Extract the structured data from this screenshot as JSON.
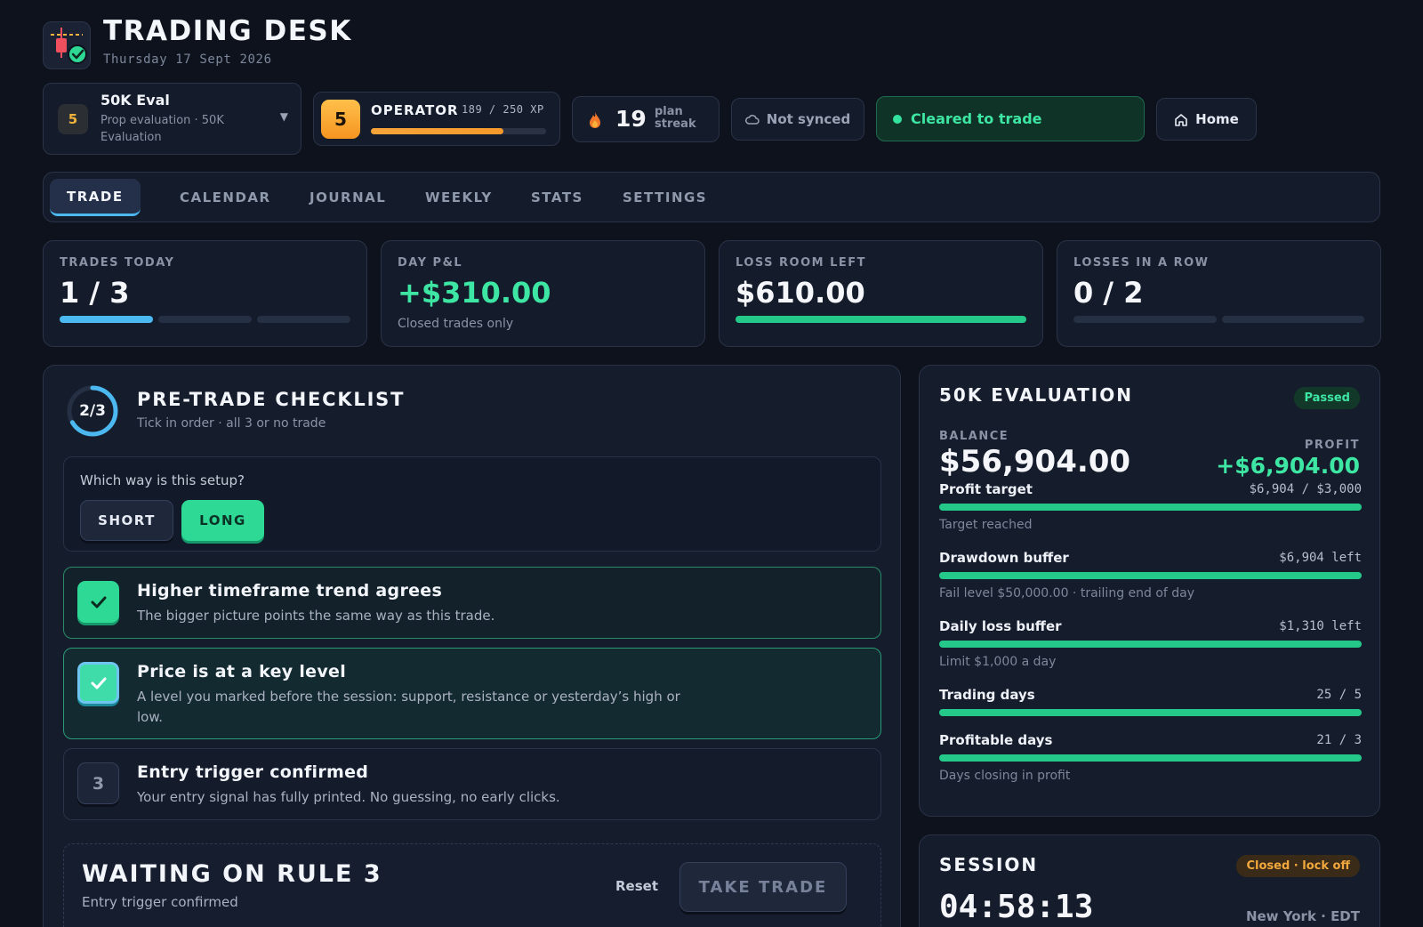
{
  "header": {
    "title": "TRADING DESK",
    "date": "Thursday 17 Sept 2026"
  },
  "account": {
    "badge": "5",
    "name": "50K Eval",
    "description": "Prop evaluation · 50K Evaluation"
  },
  "level": {
    "level": "5",
    "rank": "OPERATOR",
    "xp_text": "189 / 250 XP",
    "xp_progress": 0.756
  },
  "streak": {
    "count": "19",
    "label": "plan streak"
  },
  "sync_status": "Not synced",
  "trade_status": "Cleared to trade",
  "home_label": "Home",
  "tabs": [
    {
      "label": "TRADE"
    },
    {
      "label": "CALENDAR"
    },
    {
      "label": "JOURNAL"
    },
    {
      "label": "WEEKLY"
    },
    {
      "label": "STATS"
    },
    {
      "label": "SETTINGS"
    }
  ],
  "active_tab": "TRADE",
  "stats": {
    "trades_today": {
      "label": "TRADES TODAY",
      "value": "1 / 3",
      "used": 1,
      "max": 3
    },
    "day_pnl": {
      "label": "DAY P&L",
      "value": "+$310.00",
      "note": "Closed trades only"
    },
    "loss_room": {
      "label": "LOSS ROOM LEFT",
      "value": "$610.00",
      "fraction": 1.0
    },
    "losses_row": {
      "label": "LOSSES IN A ROW",
      "value": "0 / 2",
      "used": 0,
      "max": 2
    }
  },
  "checklist": {
    "progress": "2/3",
    "progress_fraction": 0.667,
    "title": "PRE-TRADE CHECKLIST",
    "subtitle": "Tick in order · all 3 or no trade",
    "direction_question": "Which way is this setup?",
    "short_label": "SHORT",
    "long_label": "LONG",
    "selected_direction": "LONG",
    "rules": [
      {
        "title": "Higher timeframe trend agrees",
        "desc": "The bigger picture points the same way as this trade.",
        "checked": true
      },
      {
        "title": "Price is at a key level",
        "desc": "A level you marked before the session: support, resistance or yesterday’s high or low.",
        "checked": true
      },
      {
        "number": "3",
        "title": "Entry trigger confirmed",
        "desc": "Your entry signal has fully printed. No guessing, no early clicks.",
        "checked": false
      }
    ],
    "waiting_title": "WAITING ON RULE 3",
    "waiting_sub": "Entry trigger confirmed",
    "reset_label": "Reset",
    "take_trade_label": "TAKE TRADE"
  },
  "evaluation": {
    "title": "50K EVALUATION",
    "status": "Passed",
    "balance_label": "BALANCE",
    "balance": "$56,904.00",
    "profit_label": "PROFIT",
    "profit": "+$6,904.00",
    "metrics": [
      {
        "label": "Profit target",
        "value": "$6,904 / $3,000",
        "note": "Target reached",
        "fraction": 1.0
      },
      {
        "label": "Drawdown buffer",
        "value": "$6,904 left",
        "note": "Fail level $50,000.00 · trailing end of day",
        "fraction": 1.0
      },
      {
        "label": "Daily loss buffer",
        "value": "$1,310 left",
        "note": "Limit $1,000 a day",
        "fraction": 1.0
      },
      {
        "label": "Trading days",
        "value": "25 / 5",
        "note": "",
        "fraction": 1.0
      },
      {
        "label": "Profitable days",
        "value": "21 / 3",
        "note": "Days closing in profit",
        "fraction": 1.0
      }
    ]
  },
  "session": {
    "title": "SESSION",
    "status": "Closed · lock off",
    "clock": "04:58:13",
    "timezone": "New York · EDT"
  },
  "colors": {
    "background": "#0d121d",
    "panel": "#151c2c",
    "accent_green": "#2ed895",
    "accent_blue": "#4cb8f0",
    "accent_orange": "#f59a2a"
  },
  "icons": {
    "logo": "candlestick-check-icon",
    "caret": "chevron-down-icon",
    "streak": "flame-icon",
    "sync": "cloud-icon",
    "status": "status-dot-icon",
    "home": "home-icon",
    "check": "check-icon"
  }
}
